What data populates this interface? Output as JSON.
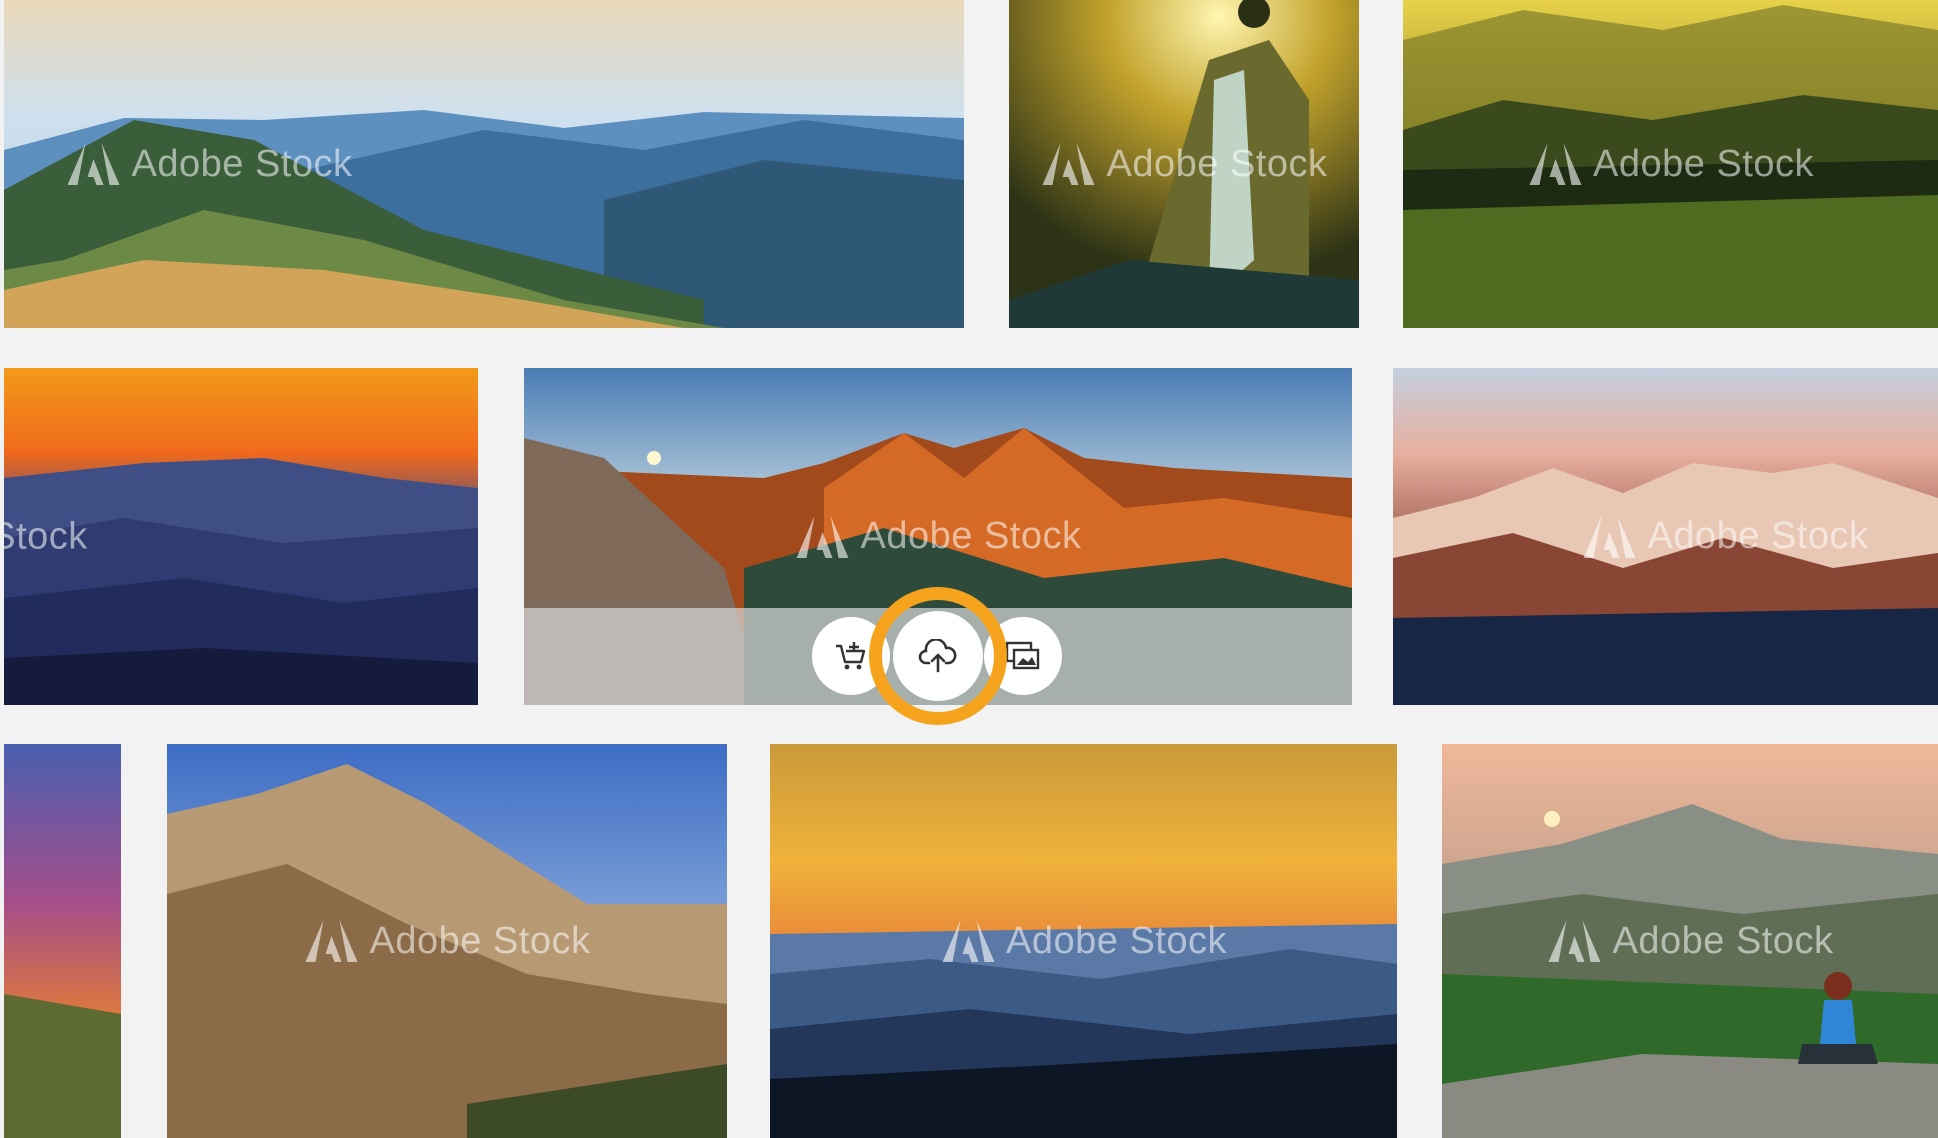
{
  "watermark": {
    "text": "Adobe Stock",
    "logo_icon": "adobe-a-logo"
  },
  "gallery": [
    {
      "id": "mountain-panorama-valley",
      "watermark_text": "Adobe Stock"
    },
    {
      "id": "waterfall-golden-light",
      "watermark_text": "Adobe Stock"
    },
    {
      "id": "misty-green-meadow",
      "watermark_text": "Adobe Stock"
    },
    {
      "id": "orange-sunset-hills",
      "watermark_text": "Stock"
    },
    {
      "id": "alpine-ridge-sunrise",
      "watermark_text": "Adobe Stock"
    },
    {
      "id": "snowy-peaks-pink-sky",
      "watermark_text": "Adobe Stock"
    },
    {
      "id": "purple-sky-crop",
      "watermark_text": ""
    },
    {
      "id": "rocky-mountain-blue-sky",
      "watermark_text": "Adobe Stock"
    },
    {
      "id": "layered-blue-ranges",
      "watermark_text": "Adobe Stock"
    },
    {
      "id": "woman-meditating-peak",
      "watermark_text": "Adobe Stock"
    }
  ],
  "hover_actions": {
    "add_to_cart_icon": "cart-plus-icon",
    "save_to_library_icon": "cloud-upload-icon",
    "find_similar_icon": "similar-images-icon",
    "highlight_color": "#f5a31c"
  }
}
